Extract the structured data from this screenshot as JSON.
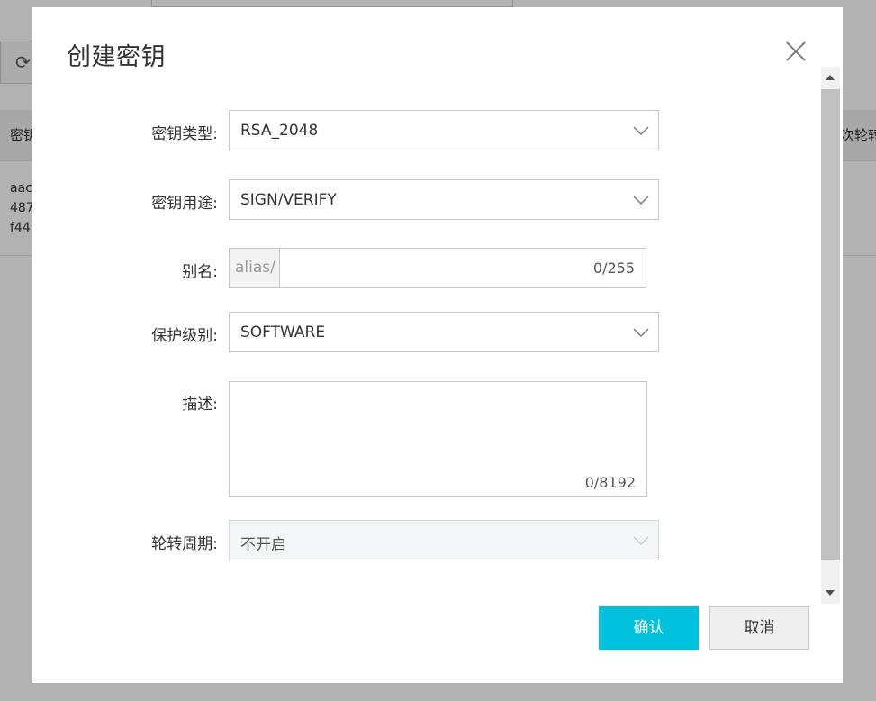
{
  "background": {
    "refresh_icon": "refresh-icon",
    "table_header_left": "密钥",
    "table_header_right": "次轮转",
    "row_cell_lines": [
      "aac",
      "487",
      "f44"
    ]
  },
  "dialog": {
    "title": "创建密钥",
    "close_icon": "close-icon",
    "fields": {
      "key_type": {
        "label": "密钥类型:",
        "value": "RSA_2048"
      },
      "key_usage": {
        "label": "密钥用途:",
        "value": "SIGN/VERIFY"
      },
      "alias": {
        "label": "别名:",
        "prefix": "alias/",
        "value": "",
        "counter": "0/255"
      },
      "protection_level": {
        "label": "保护级别:",
        "value": "SOFTWARE"
      },
      "description": {
        "label": "描述:",
        "value": "",
        "counter": "0/8192"
      },
      "rotation_period": {
        "label": "轮转周期:",
        "value": "不开启",
        "disabled": true
      }
    },
    "buttons": {
      "confirm": "确认",
      "cancel": "取消"
    }
  },
  "colors": {
    "primary": "#00c1de",
    "overlay": "rgba(0,0,0,0.3)",
    "border": "#c4c6cf"
  }
}
